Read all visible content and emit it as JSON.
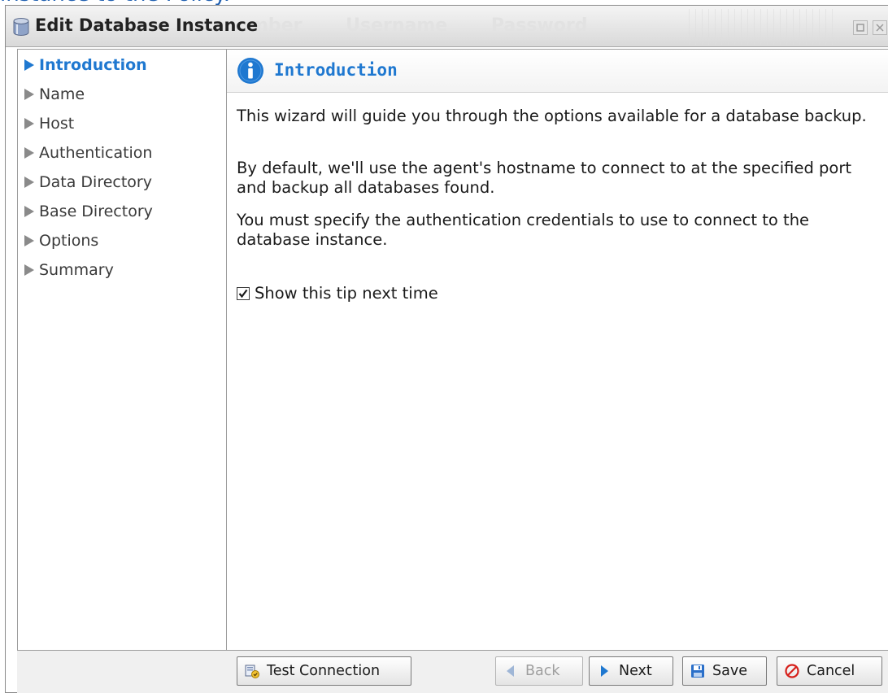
{
  "page": {
    "background_text": "instance to the Policy."
  },
  "titlebar": {
    "title": "Edit Database Instance",
    "background_columns": [
      "mber",
      "Username",
      "Password"
    ]
  },
  "sidebar": {
    "items": [
      {
        "label": "Introduction",
        "active": true
      },
      {
        "label": "Name",
        "active": false
      },
      {
        "label": "Host",
        "active": false
      },
      {
        "label": "Authentication",
        "active": false
      },
      {
        "label": "Data Directory",
        "active": false
      },
      {
        "label": "Base Directory",
        "active": false
      },
      {
        "label": "Options",
        "active": false
      },
      {
        "label": "Summary",
        "active": false
      }
    ]
  },
  "content": {
    "title": "Introduction",
    "paragraphs": [
      "This wizard will guide you through the options available for a database backup.",
      "By default, we'll use the agent's hostname to connect to at the specified port and backup all databases found.",
      "You must specify the authentication credentials to use to connect to the database instance."
    ],
    "tip_checkbox": {
      "label": "Show this tip next time",
      "checked": true
    }
  },
  "footer": {
    "test_connection": "Test Connection",
    "back": "Back",
    "next": "Next",
    "save": "Save",
    "cancel": "Cancel"
  },
  "icons": {
    "title": "database-icon",
    "info": "info-icon",
    "test_connection": "test-connection-icon",
    "back": "arrow-left-icon",
    "next": "arrow-right-icon",
    "save": "floppy-disk-icon",
    "cancel": "cancel-icon"
  },
  "colors": {
    "accent": "#1f78d0",
    "nav_inactive": "#3a3a3a",
    "disabled": "#9e9e9e"
  }
}
